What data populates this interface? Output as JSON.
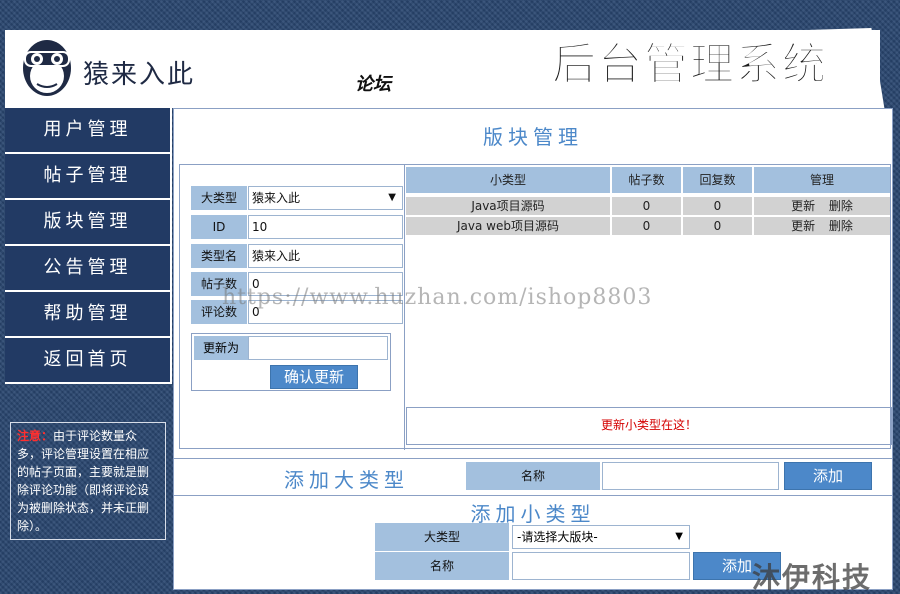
{
  "header": {
    "logo_text": "猿来入此",
    "forum_label": "论坛",
    "system_title": "后台管理系统"
  },
  "sidebar": {
    "items": [
      {
        "label": "用户管理"
      },
      {
        "label": "帖子管理"
      },
      {
        "label": "版块管理"
      },
      {
        "label": "公告管理"
      },
      {
        "label": "帮助管理"
      },
      {
        "label": "返回首页"
      }
    ],
    "notice_prefix": "注意：",
    "notice_text": "由于评论数量众多，评论管理设置在相应的帖子页面，主要就是删除评论功能（即将评论设为被删除状态，并未正删除）。"
  },
  "main": {
    "title": "版块管理",
    "edit_form": {
      "category_label": "大类型",
      "category_value": "猿来入此",
      "id_label": "ID",
      "id_value": "10",
      "type_name_label": "类型名",
      "type_name_value": "猿来入此",
      "post_count_label": "帖子数",
      "post_count_value": "0",
      "comment_count_label": "评论数",
      "comment_count_value": "0",
      "update_label": "更新为",
      "update_value": "",
      "confirm_label": "确认更新"
    },
    "table": {
      "headers": [
        "小类型",
        "帖子数",
        "回复数",
        "管理"
      ],
      "rows": [
        {
          "name": "Java项目源码",
          "posts": "0",
          "replies": "0",
          "update": "更新",
          "delete": "删除"
        },
        {
          "name": "Java web项目源码",
          "posts": "0",
          "replies": "0",
          "update": "更新",
          "delete": "删除"
        }
      ],
      "update_message": "更新小类型在这！"
    },
    "add_big": {
      "title": "添加大类型",
      "name_label": "名称",
      "name_value": "",
      "add_label": "添加"
    },
    "add_small": {
      "title": "添加小类型",
      "category_label": "大类型",
      "category_placeholder": "-请选择大版块-",
      "name_label": "名称",
      "name_value": "",
      "add_label": "添加"
    }
  },
  "overlay": {
    "watermark": "https://www.huzhan.com/ishop8803",
    "corner_brand": "沐伊科技"
  },
  "colors": {
    "accent": "#4c88c9",
    "nav_bg": "#223a64",
    "label_bg": "#a3c0de",
    "alert": "#d40000"
  }
}
